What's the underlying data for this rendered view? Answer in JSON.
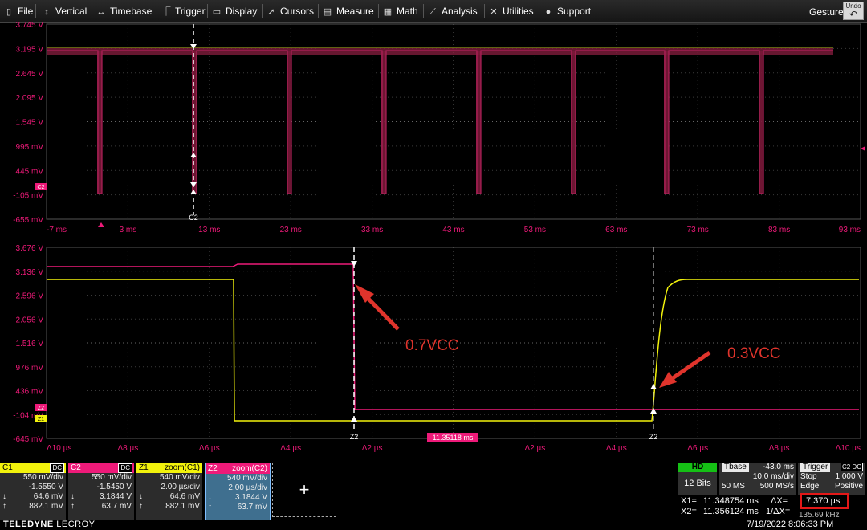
{
  "menu": {
    "items": [
      {
        "label": "File",
        "icon": "file-icon",
        "glyph": "▯"
      },
      {
        "label": "Vertical",
        "icon": "vertical-arrows-icon",
        "glyph": "↕"
      },
      {
        "label": "Timebase",
        "icon": "horizontal-arrows-icon",
        "glyph": "↔"
      },
      {
        "label": "Trigger",
        "icon": "trigger-icon",
        "glyph": "⎾"
      },
      {
        "label": "Display",
        "icon": "display-icon",
        "glyph": "▭"
      },
      {
        "label": "Cursors",
        "icon": "cursor-icon",
        "glyph": "➚"
      },
      {
        "label": "Measure",
        "icon": "measure-icon",
        "glyph": "▤"
      },
      {
        "label": "Math",
        "icon": "math-icon",
        "glyph": "▦"
      },
      {
        "label": "Analysis",
        "icon": "analysis-icon",
        "glyph": "⟋"
      },
      {
        "label": "Utilities",
        "icon": "utilities-icon",
        "glyph": "✕"
      },
      {
        "label": "Support",
        "icon": "support-icon",
        "glyph": "●"
      }
    ],
    "gesture": "Gesture",
    "undo": "Undo"
  },
  "top_grid": {
    "y_labels": [
      "3.745 V",
      "3.195 V",
      "2.645 V",
      "2.095 V",
      "1.545 V",
      "995 mV",
      "445 mV",
      "-105 mV",
      "-655 mV"
    ],
    "x_labels": [
      "-7 ms",
      "3 ms",
      "13 ms",
      "23 ms",
      "33 ms",
      "43 ms",
      "53 ms",
      "63 ms",
      "73 ms",
      "83 ms",
      "93 ms"
    ],
    "cursor_label": "C2",
    "channel_marker": "C2"
  },
  "bottom_grid": {
    "y_labels": [
      "3.676 V",
      "3.136 V",
      "2.596 V",
      "2.056 V",
      "1.516 V",
      "976 mV",
      "436 mV",
      "-104 mV",
      "-645 mV"
    ],
    "x_labels": [
      "Δ10 µs",
      "Δ8 µs",
      "Δ6 µs",
      "Δ4 µs",
      "Δ2 µs",
      "",
      "Δ2 µs",
      "Δ4 µs",
      "Δ6 µs",
      "Δ8 µs",
      "Δ10 µs"
    ],
    "center_time": "11.35118 ms",
    "cursor1_label": "Z2",
    "cursor2_label": "Z2",
    "markers": {
      "z2": "Z2",
      "z1": "Z1"
    }
  },
  "annotations": {
    "a1": "0.7VCC",
    "a2": "0.3VCC",
    "color": "#e0342c"
  },
  "colors": {
    "c1": "#f2f20c",
    "c2": "#ee1a79",
    "z1": "#f2f20c",
    "z2": "#ee1a79",
    "grid": "#3a3a3a",
    "axis_label": "#ee1a79"
  },
  "tiles": [
    {
      "name": "C1",
      "badge": "DC",
      "color": "#f2f20c",
      "rows": [
        "550 mV/div",
        "-1.5550 V",
        "64.6 mV",
        "882.1 mV"
      ]
    },
    {
      "name": "C2",
      "badge": "DC",
      "color": "#ee1a79",
      "rows": [
        "550 mV/div",
        "-1.5450 V",
        "3.1844 V",
        "63.7 mV"
      ]
    },
    {
      "name": "Z1",
      "badge": "zoom(C1)",
      "color": "#f2f20c",
      "rows": [
        "540 mV/div",
        "2.00 µs/div",
        "64.6 mV",
        "882.1 mV"
      ]
    },
    {
      "name": "Z2",
      "badge": "zoom(C2)",
      "color": "#ee1a79",
      "rows": [
        "540 mV/div",
        "2.00 µs/div",
        "3.1844 V",
        "63.7 mV"
      ]
    }
  ],
  "add_tile": "+",
  "acq": {
    "hd": "HD",
    "bits": "12 Bits",
    "tbase_label": "Tbase",
    "tbase_value": "-43.0 ms",
    "timebase": "10.0 ms/div",
    "sample_pts": "50 MS",
    "sample_rate": "500 MS/s",
    "trigger_label": "Trigger",
    "trigger_badge": "C2 DC",
    "trigger_mode": "Stop",
    "trigger_level": "1.000 V",
    "trigger_type": "Edge",
    "trigger_slope": "Positive"
  },
  "measurements": {
    "x1_label": "X1=",
    "x1": "11.348754 ms",
    "x2_label": "X2=",
    "x2": "11.356124 ms",
    "dx_label": "ΔX=",
    "dx": "7.370 µs",
    "inv_dx_label": "1/ΔX=",
    "inv_dx": "135.69 kHz"
  },
  "footer": {
    "brand": "TELEDYNE",
    "brand2": "LECROY",
    "datetime": "7/19/2022 8:06:33 PM"
  }
}
